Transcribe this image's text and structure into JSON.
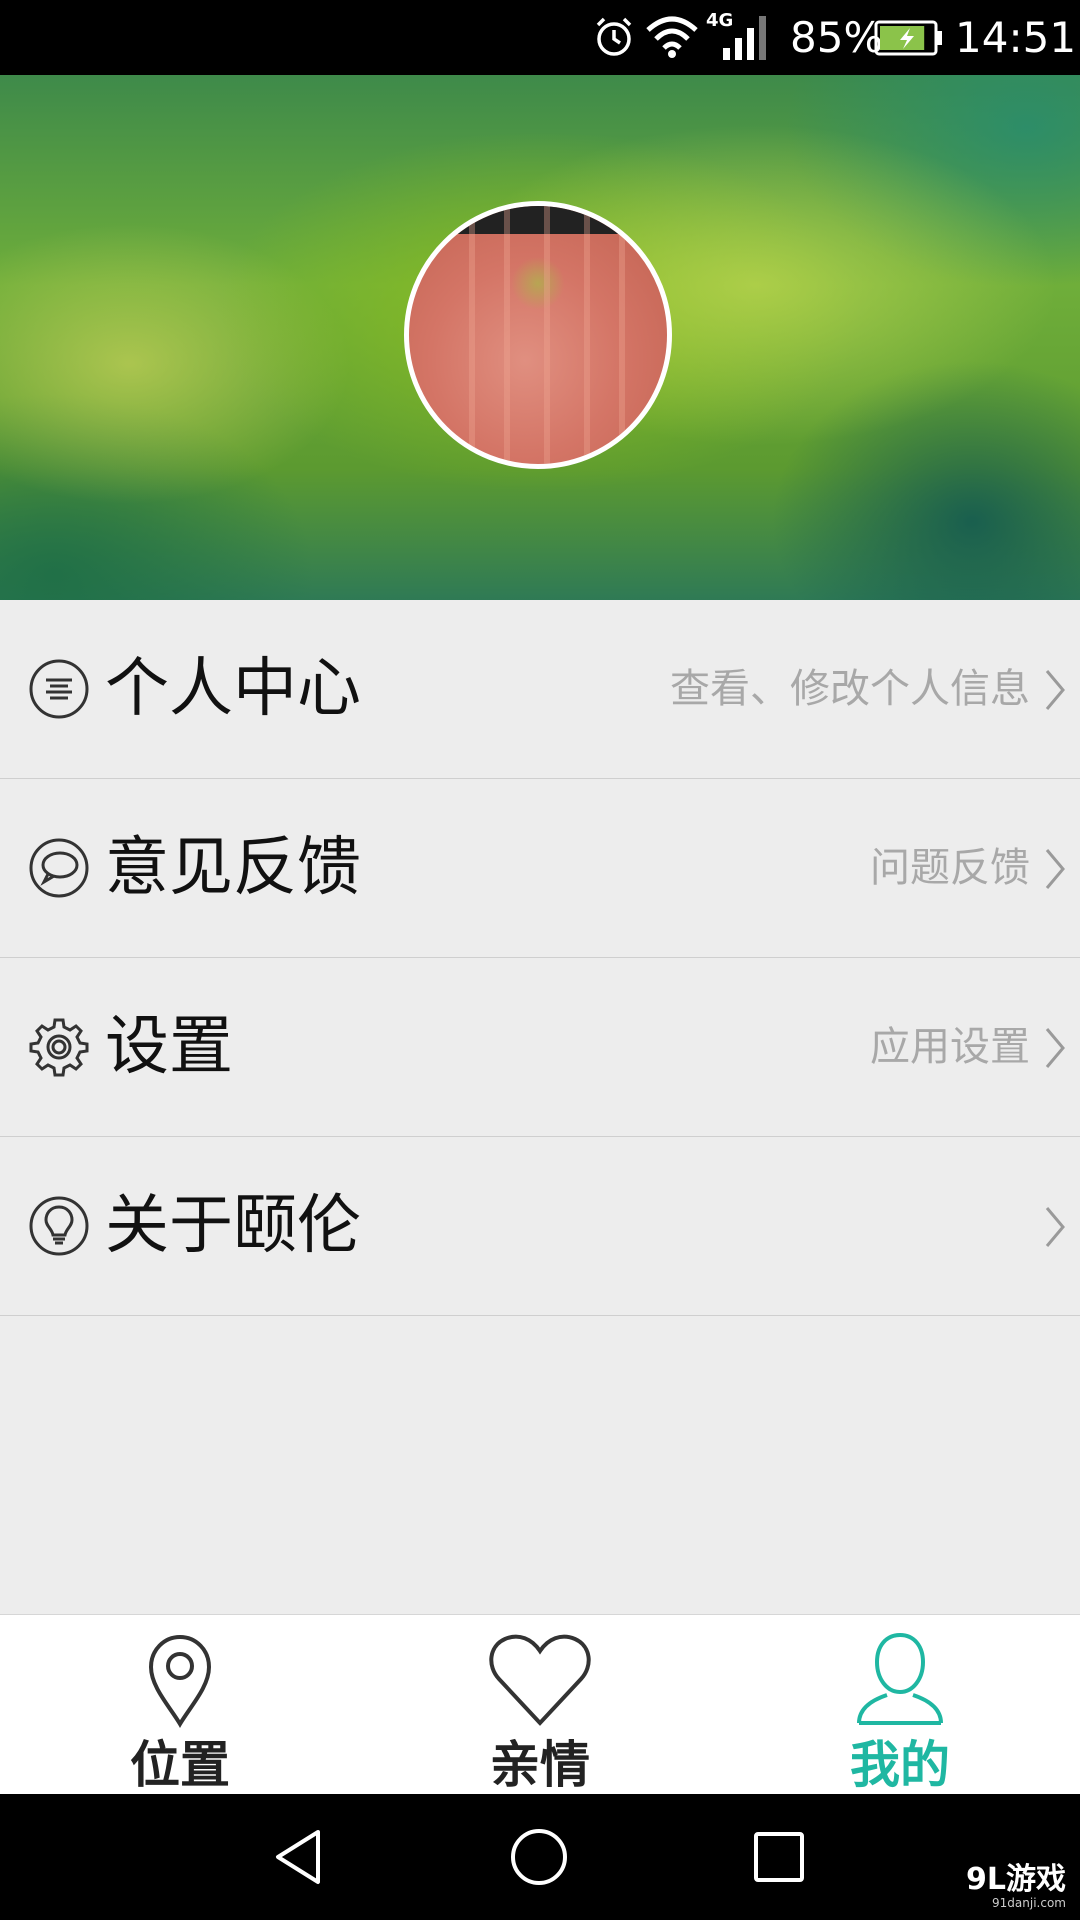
{
  "status_bar": {
    "network_type": "4G",
    "battery_percent": "85%",
    "battery_level": 0.85,
    "time": "14:51",
    "icons": [
      "alarm-icon",
      "wifi-icon",
      "signal-icon",
      "battery-charging-icon"
    ]
  },
  "header": {
    "avatar": "apple-photo"
  },
  "menu": {
    "items": [
      {
        "title": "个人中心",
        "hint": "查看、修改个人信息",
        "icon": "profile-list-icon"
      },
      {
        "title": "意见反馈",
        "hint": "问题反馈",
        "icon": "chat-bubble-icon"
      },
      {
        "title": "设置",
        "hint": "应用设置",
        "icon": "gear-icon"
      },
      {
        "title": "关于颐伦",
        "hint": "",
        "icon": "lightbulb-icon"
      }
    ]
  },
  "bottom_nav": {
    "tabs": [
      {
        "label": "位置",
        "icon": "location-pin-icon",
        "active": false
      },
      {
        "label": "亲情",
        "icon": "heart-icon",
        "active": false
      },
      {
        "label": "我的",
        "icon": "user-icon",
        "active": true
      }
    ],
    "active_color": "#1fb7a2"
  },
  "system_nav": {
    "buttons": [
      "back-icon",
      "home-icon",
      "recents-icon"
    ]
  },
  "watermark": {
    "main": "9L游戏",
    "sub": "91danji.com"
  }
}
